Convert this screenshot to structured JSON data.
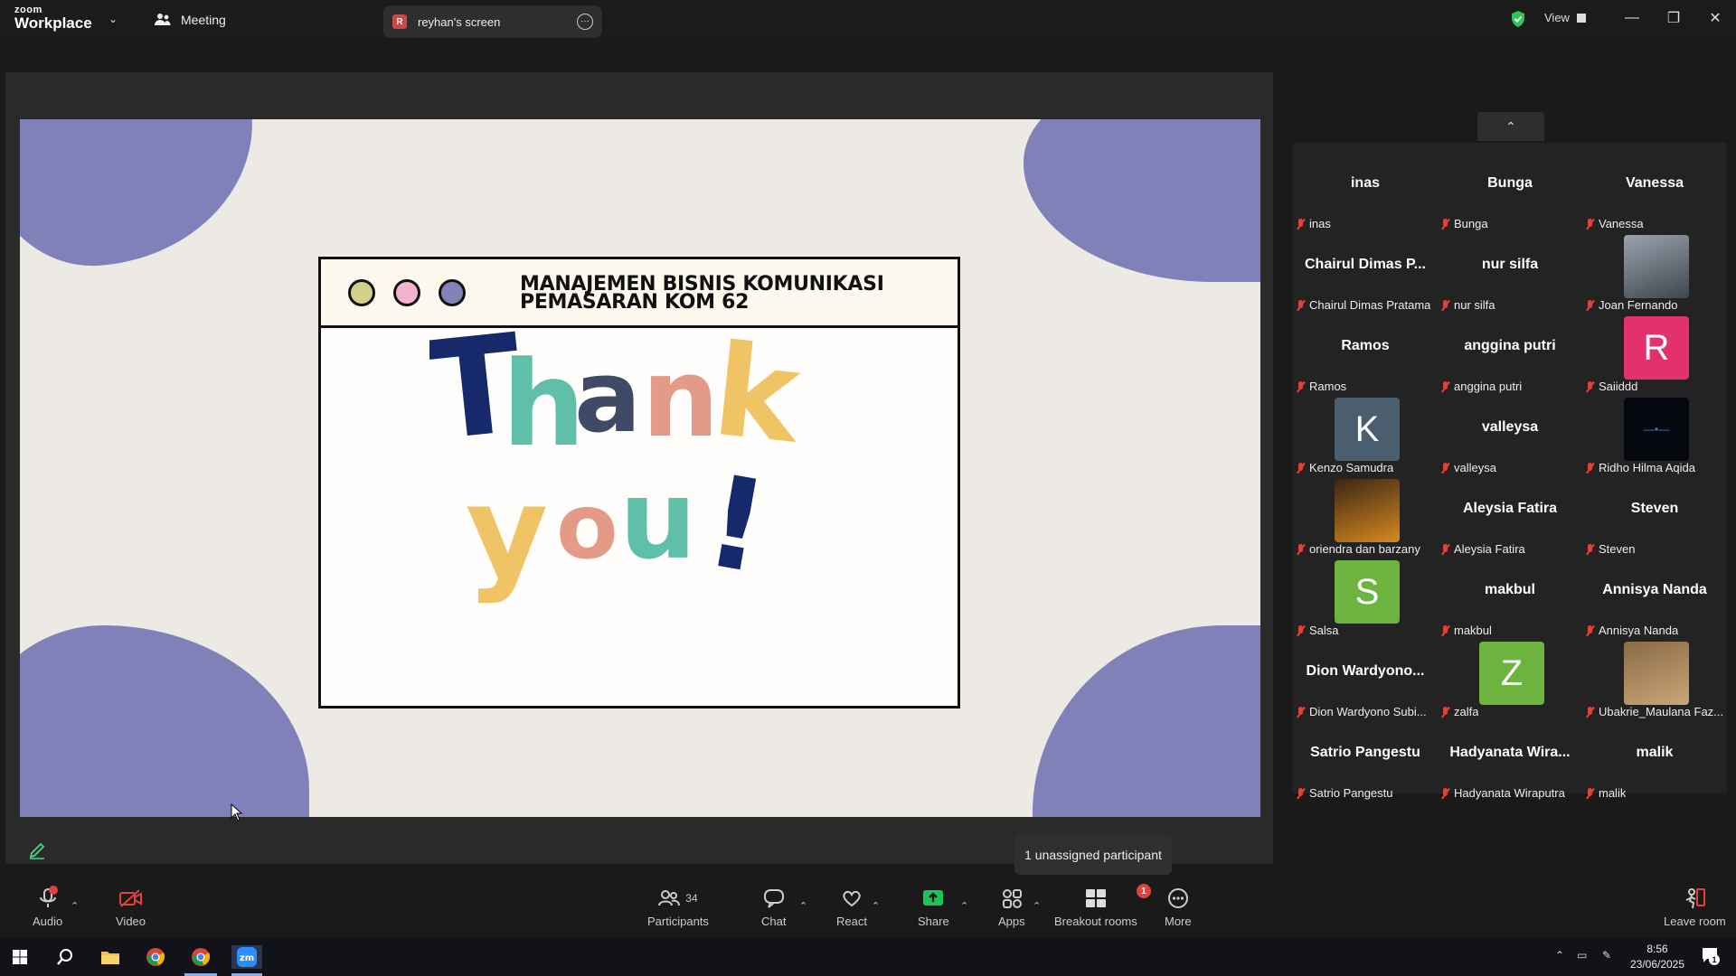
{
  "app": {
    "logo_line1": "zoom",
    "logo_line2": "Workplace",
    "meeting_tab": "Meeting",
    "share_tab": "reyhan's screen",
    "share_tab_initial": "R",
    "view_label": "View"
  },
  "slide": {
    "title_line1": "MANAJEMEN BISNIS KOMUNIKASI",
    "title_line2": "PEMASARAN KOM 62",
    "big_text_line1": "Thank",
    "big_text_line2": "you!",
    "colors": {
      "background": "#ede9e4",
      "blob": "#7f81b8",
      "dot1": "#d4cf8a",
      "dot2": "#f2b3d0",
      "dot3": "#8082b8",
      "navy": "#15296b",
      "teal": "#5fbfa8",
      "slate": "#3f4a66",
      "salmon": "#e39a86",
      "yellow": "#f0c465"
    }
  },
  "gallery": {
    "participants": [
      {
        "big": "inas",
        "label": "inas"
      },
      {
        "big": "Bunga",
        "label": "Bunga"
      },
      {
        "big": "Vanessa",
        "label": "Vanessa"
      },
      {
        "big": "Chairul Dimas P...",
        "label": "Chairul Dimas Pratama"
      },
      {
        "big": "nur silfa",
        "label": "nur silfa"
      },
      {
        "big": "",
        "label": "Joan Fernando",
        "avatar": "photo"
      },
      {
        "big": "Ramos",
        "label": "Ramos"
      },
      {
        "big": "anggina putri",
        "label": "anggina putri"
      },
      {
        "big": "R",
        "label": "Saiiddd",
        "avatar": "letter",
        "avatar_color": "#e3306e"
      },
      {
        "big": "K",
        "label": "Kenzo Samudra",
        "avatar": "letter",
        "avatar_color": "#4b5e70"
      },
      {
        "big": "valleysa",
        "label": "valleysa"
      },
      {
        "big": "",
        "label": "Ridho Hilma Aqida",
        "avatar": "video-dark"
      },
      {
        "big": "",
        "label": "oriendra dan barzany",
        "avatar": "photo-orange"
      },
      {
        "big": "Aleysia Fatira",
        "label": "Aleysia Fatira"
      },
      {
        "big": "Steven",
        "label": "Steven"
      },
      {
        "big": "S",
        "label": "Salsa",
        "avatar": "letter",
        "avatar_color": "#6db33f"
      },
      {
        "big": "makbul",
        "label": "makbul"
      },
      {
        "big": "Annisya Nanda",
        "label": "Annisya Nanda"
      },
      {
        "big": "Dion Wardyono...",
        "label": "Dion Wardyono Subi..."
      },
      {
        "big": "Z",
        "label": "zalfa",
        "avatar": "letter",
        "avatar_color": "#6db33f"
      },
      {
        "big": "",
        "label": "Ubakrie_Maulana Faz...",
        "avatar": "photo-brown"
      },
      {
        "big": "Satrio Pangestu",
        "label": "Satrio Pangestu"
      },
      {
        "big": "Hadyanata Wira...",
        "label": "Hadyanata Wiraputra"
      },
      {
        "big": "malik",
        "label": "malik"
      }
    ]
  },
  "tooltip": "1 unassigned participant",
  "toolbar": {
    "audio": "Audio",
    "video": "Video",
    "participants": "Participants",
    "participants_count": "34",
    "chat": "Chat",
    "react": "React",
    "share": "Share",
    "apps": "Apps",
    "breakout": "Breakout rooms",
    "breakout_badge": "1",
    "more": "More",
    "leave": "Leave room"
  },
  "taskbar": {
    "time": "8:56",
    "date": "23/06/2025",
    "notif_count": "1"
  }
}
